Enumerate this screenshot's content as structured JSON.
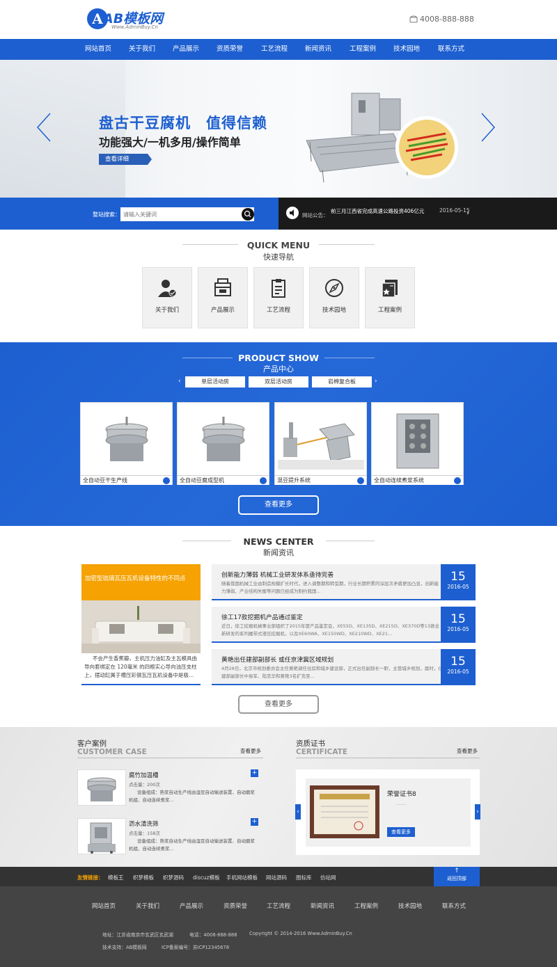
{
  "header": {
    "logo_text": "AB模板网",
    "logo_sub": "Www.AdminBuy.Cn",
    "phone": "4008-888-888"
  },
  "nav": [
    "网站首页",
    "关于我们",
    "产品展示",
    "资质荣誉",
    "工艺流程",
    "新闻资讯",
    "工程案例",
    "技术园地",
    "联系方式"
  ],
  "banner": {
    "title": "盘古干豆腐机　值得信赖",
    "subtitle": "功能强大/一机多用/操作简单",
    "button": "查看详细"
  },
  "search": {
    "label": "整站搜索：",
    "placeholder": "请输入关键词"
  },
  "notice": {
    "label": "网站公告：",
    "text": "前三月江西省完成高速公路投资406亿元",
    "date": "2016-05-15"
  },
  "quick": {
    "title": "QUICK MENU",
    "subtitle": "快速导航",
    "items": [
      "关于我们",
      "产品展示",
      "工艺流程",
      "技术园地",
      "工程案例"
    ]
  },
  "product": {
    "title": "PRODUCT SHOW",
    "subtitle": "产品中心",
    "tabs": [
      "单层活动房",
      "双层活动房",
      "岩棉复合板"
    ],
    "items": [
      "全自动豆干生产线",
      "全自动豆腐成型机",
      "混豆提升系统",
      "全自动连续煮浆系统"
    ],
    "more": "查看更多"
  },
  "news": {
    "title": "NEWS CENTER",
    "subtitle": "新闻资讯",
    "featured": {
      "title": "加密型琉璃瓦压瓦机设备特性的不同点",
      "text": "不会产生香蕉瓣，主机压力油缸及主瓦模具由导向套绑定在 120毫米 的四根实心导向油压支柱上，摆动缸属于槽压彩钢瓦压瓦机设备中是极..."
    },
    "items": [
      {
        "title": "创新能力薄弱 机械工业研发体系亟待完善",
        "desc": "随着我国机械工业由制造规模扩长时代，进入调整期和转型期，行业长期积累的深层次矛盾更加凸显，创新能力薄弱、产业结构失衡等问题已经成为制约我国...",
        "day": "15",
        "ym": "2016-05"
      },
      {
        "title": "徐工17款挖掘机产品通过鉴定",
        "desc": "近日，徐工挖掘机械事业部组织了2015年度产品鉴定会，XE55D、XE135D、XE215D、XE370D等13款全新研发的系列履带式液压挖掘机，以及XE60WA、XE150WD、XE210WD、XE21...",
        "day": "15",
        "ym": "2016-05"
      },
      {
        "title": "黄艳出任建部副部长 或任京津冀区域规划",
        "desc": "4月28日，北京市规划委员会主任黄艳调任住房和城乡建设部，正式出任副部长一职，主管城乡规划，届时，住建部副部长中易军、陆克华和黄艳3名扩充至...",
        "day": "15",
        "ym": "2016-05"
      }
    ],
    "more": "查看更多"
  },
  "cases": {
    "title_zh": "客户案例",
    "title_en": "CUSTOMER CASE",
    "more": "查看更多",
    "items": [
      {
        "name": "腐竹加温槽",
        "count": "点击量：200次",
        "desc": "设备组成：熟浆自动生产线由湿豆自动输送装置、自动磨浆机组、自动连续煮浆..."
      },
      {
        "name": "沥水清洗筛",
        "count": "点击量：158次",
        "desc": "设备组成：熟浆自动生产线由湿豆自动输送装置、自动磨浆机组、自动连续煮浆..."
      }
    ]
  },
  "cert": {
    "title_zh": "资质证书",
    "title_en": "CERTIFICATE",
    "more": "查看更多",
    "name": "荣誉证书8",
    "dots": "……",
    "button": "查看更多"
  },
  "links": {
    "label": "友情链接：",
    "items": [
      "模板王",
      "织梦模板",
      "织梦源码",
      "discuz模板",
      "手机网站模板",
      "网站源码",
      "图标库",
      "仿站网"
    ],
    "backtop": "返回顶部"
  },
  "footer": {
    "nav": [
      "网站首页",
      "关于我们",
      "产品展示",
      "资质荣誉",
      "工艺流程",
      "新闻资讯",
      "工程案例",
      "技术园地",
      "联系方式"
    ],
    "address": "地址：江苏省南京市玄武区玄武湖",
    "phone": "电话：4008-888-888",
    "copyright": "Copyright © 2014-2016 Www.AdminBuy.Cn",
    "support": "技术支持：AB模板网",
    "icp": "ICP备案编号：苏ICP12345678"
  },
  "colors": {
    "brand": "#1d5fd0",
    "accent": "#f5a202"
  }
}
